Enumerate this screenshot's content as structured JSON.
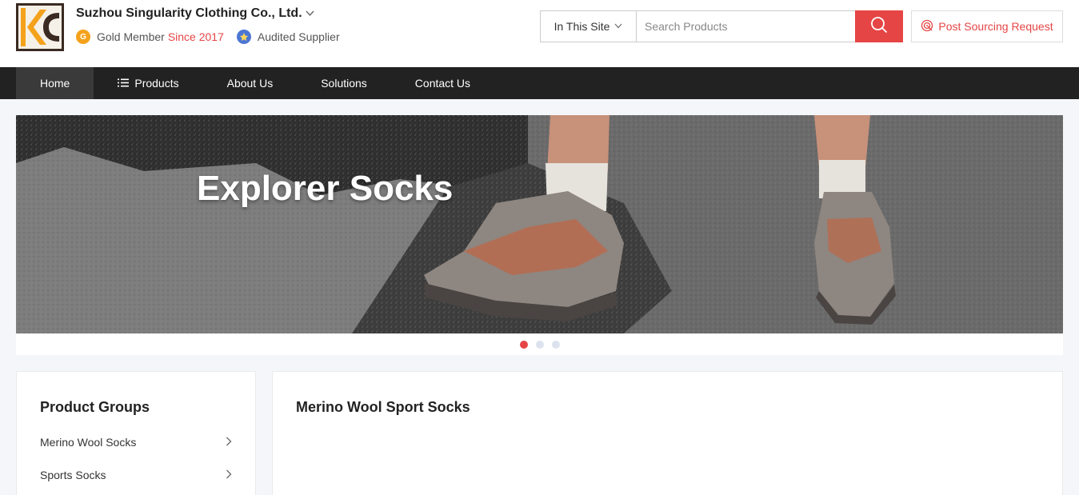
{
  "company": {
    "name": "Suzhou Singularity Clothing Co., Ltd.",
    "gold_member_label": "Gold Member",
    "since_label": "Since 2017",
    "audited_label": "Audited Supplier"
  },
  "search": {
    "scope_label": "In This Site",
    "placeholder": "Search Products"
  },
  "sourcing": {
    "label": "Post Sourcing Request"
  },
  "nav": {
    "items": [
      {
        "label": "Home"
      },
      {
        "label": "Products"
      },
      {
        "label": "About Us"
      },
      {
        "label": "Solutions"
      },
      {
        "label": "Contact Us"
      }
    ]
  },
  "banner": {
    "title": "Explorer Socks",
    "slide_count": 3,
    "active_slide": 1
  },
  "sidebar": {
    "title": "Product Groups",
    "items": [
      {
        "label": "Merino Wool Socks"
      },
      {
        "label": "Sports Socks"
      }
    ]
  },
  "main": {
    "title": "Merino Wool Sport Socks"
  },
  "colors": {
    "accent": "#e64545",
    "nav_bg": "#222222",
    "gold": "#f4a21c",
    "audit_blue": "#4b76d4"
  }
}
